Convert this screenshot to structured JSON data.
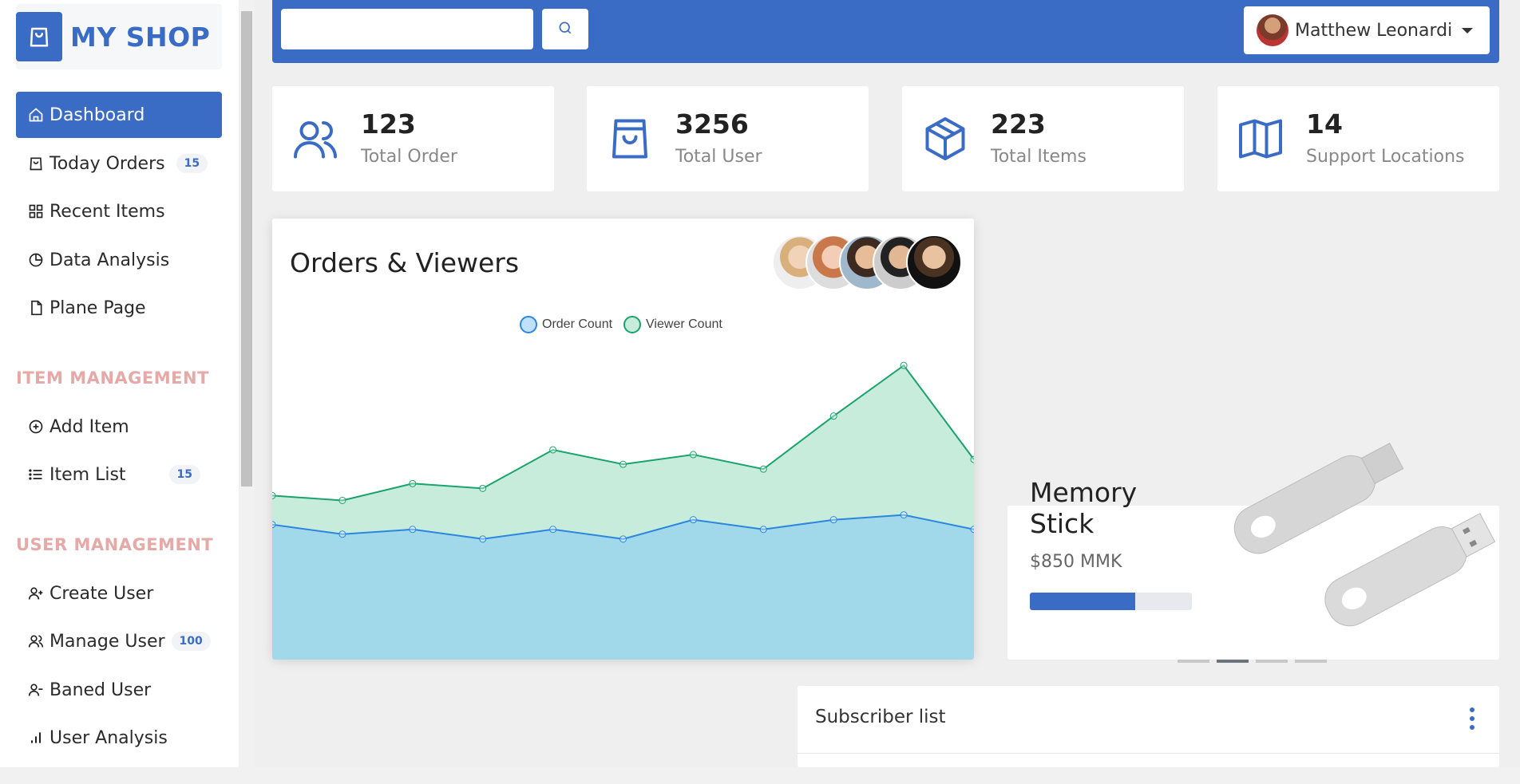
{
  "brand": {
    "title": "MY SHOP",
    "icon": "shopping-bag-icon",
    "color": "#3a6cc6"
  },
  "sidebar": {
    "items": [
      {
        "label": "Dashboard",
        "icon": "home-icon",
        "active": true
      },
      {
        "label": "Today Orders",
        "icon": "shopping-bag-icon",
        "badge": "15"
      },
      {
        "label": "Recent Items",
        "icon": "grid-icon"
      },
      {
        "label": "Data Analysis",
        "icon": "pie-chart-icon"
      },
      {
        "label": "Plane Page",
        "icon": "file-icon"
      }
    ],
    "item_section_title": "ITEM MANAGEMENT",
    "item_items": [
      {
        "label": "Add Item",
        "icon": "plus-circle-icon"
      },
      {
        "label": "Item List",
        "icon": "list-icon",
        "badge": "15"
      }
    ],
    "user_section_title": "USER MANAGEMENT",
    "user_items": [
      {
        "label": "Create User",
        "icon": "user-plus-icon"
      },
      {
        "label": "Manage User",
        "icon": "users-icon",
        "badge": "100"
      },
      {
        "label": "Baned User",
        "icon": "user-minus-icon"
      },
      {
        "label": "User Analysis",
        "icon": "bar-chart-icon"
      }
    ]
  },
  "topbar": {
    "search_value": "",
    "search_icon": "search-icon",
    "user_name": "Matthew Leonardi"
  },
  "stats": [
    {
      "value": "123",
      "label": "Total Order",
      "icon": "users-icon"
    },
    {
      "value": "3256",
      "label": "Total User",
      "icon": "shopping-bag-icon"
    },
    {
      "value": "223",
      "label": "Total Items",
      "icon": "box-icon"
    },
    {
      "value": "14",
      "label": "Support Locations",
      "icon": "map-icon"
    }
  ],
  "chart": {
    "title": "Orders & Viewers",
    "legend": [
      "Order Count",
      "Viewer Count"
    ]
  },
  "chart_data": {
    "type": "area",
    "x": [
      0,
      1,
      2,
      3,
      4,
      5,
      6,
      7,
      8,
      9,
      10
    ],
    "series": [
      {
        "name": "Viewer Count",
        "color": "#1aa36a",
        "fill": "#c8ecdc",
        "values": [
          68,
          66,
          73,
          71,
          87,
          81,
          85,
          79,
          101,
          122,
          83
        ]
      },
      {
        "name": "Order Count",
        "color": "#2b86de",
        "fill": "#a1d8ea",
        "values": [
          56,
          52,
          54,
          50,
          54,
          50,
          58,
          54,
          58,
          60,
          54
        ]
      }
    ],
    "ylim": [
      0,
      130
    ],
    "grid": false,
    "legend": "top"
  },
  "product": {
    "name": "Memory Stick",
    "price": "$850 MMK",
    "progress": 0.65,
    "slides": 4,
    "active_slide": 1
  },
  "subscriber": {
    "title": "Subscriber list"
  }
}
